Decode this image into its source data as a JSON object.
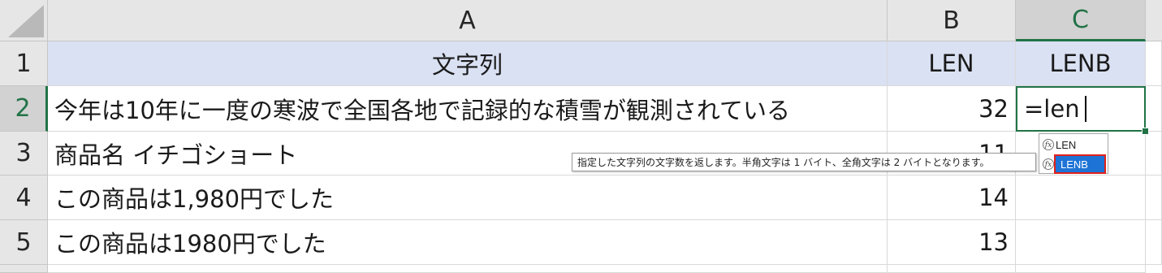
{
  "columns": {
    "a": "A",
    "b": "B",
    "c": "C"
  },
  "rows": [
    "1",
    "2",
    "3",
    "4",
    "5"
  ],
  "header_row": {
    "a": "文字列",
    "b": "LEN",
    "c": "LENB"
  },
  "data_rows": [
    {
      "a": "今年は10年に一度の寒波で全国各地で記録的な積雪が観測されている",
      "b": "32",
      "c": ""
    },
    {
      "a": "商品名 イチゴショート",
      "b": "11",
      "c": ""
    },
    {
      "a": "この商品は1,980円でした",
      "b": "14",
      "c": ""
    },
    {
      "a": "この商品は1980円でした",
      "b": "13",
      "c": ""
    }
  ],
  "editing_cell": {
    "ref": "C2",
    "value": "=len"
  },
  "autocomplete": {
    "items": [
      {
        "label": "LEN",
        "icon": "function-icon"
      },
      {
        "label": "LENB",
        "icon": "function-icon",
        "selected": true
      }
    ],
    "tooltip": "指定した文字列の文字数を返します。半角文字は 1 バイト、全角文字は 2 バイトとなります。"
  },
  "colors": {
    "accent": "#217346",
    "header_fill": "#dae1f3",
    "selection": "#1e74d6",
    "highlight_outline": "#e0201b"
  }
}
